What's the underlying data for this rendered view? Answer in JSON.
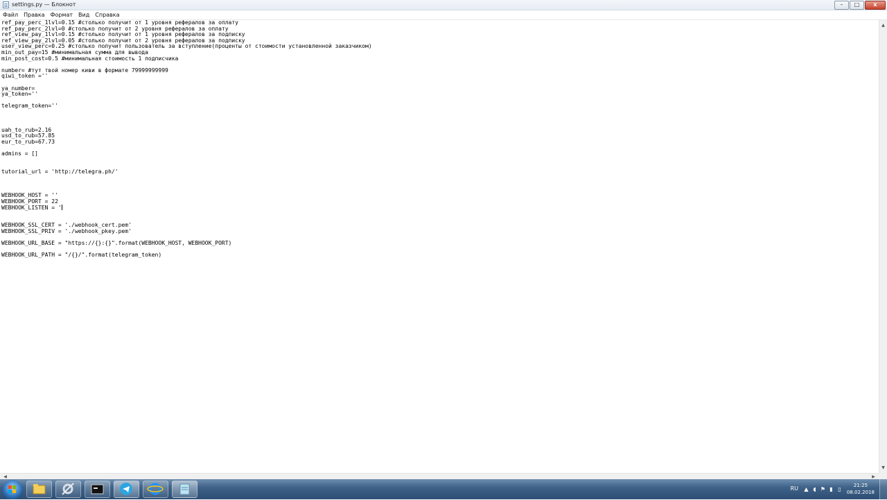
{
  "window": {
    "title": "settings.py — Блокнот",
    "icon": "notepad-icon",
    "buttons": {
      "minimize": "–",
      "maximize": "□",
      "close": "x"
    }
  },
  "menu": [
    "Файл",
    "Правка",
    "Формат",
    "Вид",
    "Справка"
  ],
  "editor": {
    "lines": [
      "ref_pay_perc_1lvl=0.15 #столько получит от 1 уровня рефералов за оплату",
      "ref_pay_perc_2lvl=0 #столько получит от 2 уровня рефералов за оплату",
      "ref_view_pay_1lvl=0.15 #столько получит от 1 уровня рефералов за подписку",
      "ref_view_pay_2lvl=0.05 #столько получит от 2 уровня рефералов за подписку",
      "user_view_perc=0.25 #столько получит пользователь за вступление(проценты от стоимости установленной заказчиком)",
      "min_out_pay=15 #минимальная сумма для вывода",
      "min_post_cost=0.5 #минимальная стоимость 1 подписчика",
      "",
      "number= #тут твой номер киви в формате 79999999999",
      "qiwi_token =''",
      "",
      "ya_number=",
      "ya_token=''",
      "",
      "telegram_token=''",
      "",
      "",
      "",
      "uah_to_rub=2.16",
      "usd_to_rub=57.85",
      "eur_to_rub=67.73",
      "",
      "admins = []",
      "",
      "",
      "tutorial_url = 'http://telegra.ph/'",
      "",
      "",
      "",
      "WEBHOOK_HOST = ''",
      "WEBHOOK_PORT = 22",
      "WEBHOOK_LISTEN = '",
      "",
      "",
      "WEBHOOK_SSL_CERT = './webhook_cert.pem'",
      "WEBHOOK_SSL_PRIV = './webhook_pkey.pem'",
      "",
      "WEBHOOK_URL_BASE = \"https://{}:{}\".format(WEBHOOK_HOST, WEBHOOK_PORT)",
      "",
      "WEBHOOK_URL_PATH = \"/{}/\".format(telegram_token)"
    ],
    "caret_line": 31
  },
  "taskbar": {
    "start": "windows-start-icon",
    "apps": [
      {
        "name": "explorer-icon",
        "active": false
      },
      {
        "name": "tools-icon",
        "active": false
      },
      {
        "name": "terminal-icon",
        "active": false
      },
      {
        "name": "telegram-icon",
        "active": true
      },
      {
        "name": "internet-explorer-icon",
        "active": false
      },
      {
        "name": "notepad-icon",
        "active": true
      }
    ],
    "language": "RU",
    "clock": {
      "time": "21:25",
      "date": "08.02.2018"
    }
  }
}
